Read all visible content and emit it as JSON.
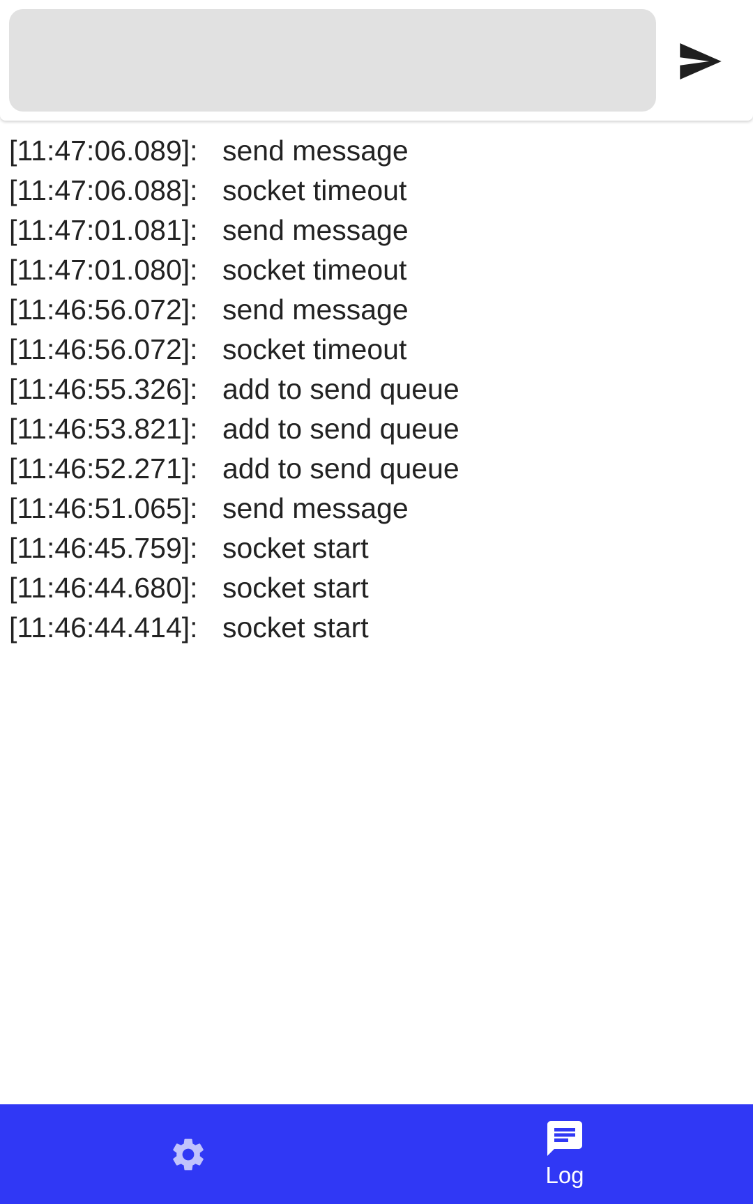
{
  "input": {
    "value": "",
    "placeholder": ""
  },
  "send_button": {
    "icon": "send-icon"
  },
  "log": [
    {
      "time": "[11:47:06.089]:",
      "message": "send message"
    },
    {
      "time": "[11:47:06.088]:",
      "message": "socket timeout"
    },
    {
      "time": "[11:47:01.081]:",
      "message": "send message"
    },
    {
      "time": "[11:47:01.080]:",
      "message": "socket timeout"
    },
    {
      "time": "[11:46:56.072]:",
      "message": "send message"
    },
    {
      "time": "[11:46:56.072]:",
      "message": "socket timeout"
    },
    {
      "time": "[11:46:55.326]:",
      "message": "add to send queue"
    },
    {
      "time": "[11:46:53.821]:",
      "message": "add to send queue"
    },
    {
      "time": "[11:46:52.271]:",
      "message": "add to send queue"
    },
    {
      "time": "[11:46:51.065]:",
      "message": "send message"
    },
    {
      "time": "[11:46:45.759]:",
      "message": "socket start"
    },
    {
      "time": "[11:46:44.680]:",
      "message": "socket start"
    },
    {
      "time": "[11:46:44.414]:",
      "message": "socket start"
    }
  ],
  "bottom_nav": {
    "items": [
      {
        "icon": "gear-icon",
        "label": "",
        "active": false
      },
      {
        "icon": "chat-icon",
        "label": "Log",
        "active": true
      }
    ]
  },
  "colors": {
    "nav_background": "#3038f5",
    "input_background": "#e1e1e1",
    "text": "#222222"
  }
}
